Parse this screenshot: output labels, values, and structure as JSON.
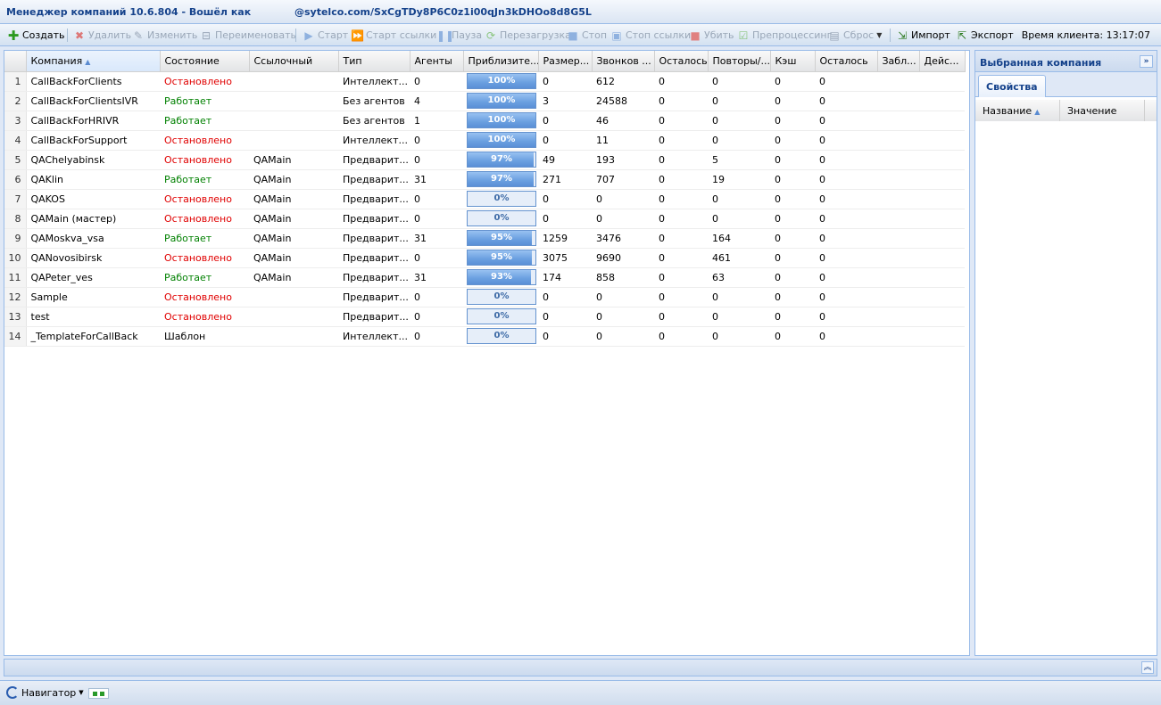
{
  "window": {
    "title": "Менеджер компаний 10.6.804 - Вошёл как",
    "user": "@sytelco.com/SxCgTDy8P6C0z1i00qJn3kDHOo8d8G5L"
  },
  "toolbar": {
    "create": "Создать",
    "delete": "Удалить",
    "edit": "Изменить",
    "rename": "Переименовать",
    "start": "Старт",
    "start_links": "Старт ссылки",
    "pause": "Пауза",
    "restart": "Перезагрузка",
    "stop": "Стоп",
    "stop_links": "Стоп ссылки",
    "kill": "Убить",
    "preprocess": "Препроцессинг",
    "reset": "Сброс",
    "import": "Импорт",
    "export": "Экспорт",
    "client_time_label": "Время клиента:",
    "client_time": "13:17:07"
  },
  "grid": {
    "columns": [
      "Компания",
      "Состояние",
      "Ссылочный",
      "Тип",
      "Агенты",
      "Приблизите...",
      "Размер...",
      "Звонков ...",
      "Осталось",
      "Повторы/...",
      "Кэш",
      "Осталось",
      "Забл...",
      "Дейс..."
    ],
    "rows": [
      {
        "n": "1",
        "name": "CallBackForClients",
        "state": "Остановлено",
        "running": false,
        "ref": "",
        "type": "Интеллект...",
        "agents": "0",
        "progress": 100,
        "progress_label": "100%",
        "size": "0",
        "calls": "612",
        "left": "0",
        "retries": "0",
        "cache": "0",
        "left2": "0"
      },
      {
        "n": "2",
        "name": "CallBackForClientsIVR",
        "state": "Работает",
        "running": true,
        "ref": "",
        "type": "Без агентов",
        "agents": "4",
        "progress": 100,
        "progress_label": "100%",
        "size": "3",
        "calls": "24588",
        "left": "0",
        "retries": "0",
        "cache": "0",
        "left2": "0"
      },
      {
        "n": "3",
        "name": "CallBackForHRIVR",
        "state": "Работает",
        "running": true,
        "ref": "",
        "type": "Без агентов",
        "agents": "1",
        "progress": 100,
        "progress_label": "100%",
        "size": "0",
        "calls": "46",
        "left": "0",
        "retries": "0",
        "cache": "0",
        "left2": "0"
      },
      {
        "n": "4",
        "name": "CallBackForSupport",
        "state": "Остановлено",
        "running": false,
        "ref": "",
        "type": "Интеллект...",
        "agents": "0",
        "progress": 100,
        "progress_label": "100%",
        "size": "0",
        "calls": "11",
        "left": "0",
        "retries": "0",
        "cache": "0",
        "left2": "0"
      },
      {
        "n": "5",
        "name": "QAChelyabinsk",
        "state": "Остановлено",
        "running": false,
        "ref": "QAMain",
        "type": "Предварит...",
        "agents": "0",
        "progress": 97,
        "progress_label": "97%",
        "size": "49",
        "calls": "193",
        "left": "0",
        "retries": "5",
        "cache": "0",
        "left2": "0"
      },
      {
        "n": "6",
        "name": "QAKlin",
        "state": "Работает",
        "running": true,
        "ref": "QAMain",
        "type": "Предварит...",
        "agents": "31",
        "progress": 97,
        "progress_label": "97%",
        "size": "271",
        "calls": "707",
        "left": "0",
        "retries": "19",
        "cache": "0",
        "left2": "0"
      },
      {
        "n": "7",
        "name": "QAKOS",
        "state": "Остановлено",
        "running": false,
        "ref": "QAMain",
        "type": "Предварит...",
        "agents": "0",
        "progress": 0,
        "progress_label": "0%",
        "size": "0",
        "calls": "0",
        "left": "0",
        "retries": "0",
        "cache": "0",
        "left2": "0"
      },
      {
        "n": "8",
        "name": "QAMain (мастер)",
        "state": "Остановлено",
        "running": false,
        "ref": "QAMain",
        "type": "Предварит...",
        "agents": "0",
        "progress": 0,
        "progress_label": "0%",
        "size": "0",
        "calls": "0",
        "left": "0",
        "retries": "0",
        "cache": "0",
        "left2": "0"
      },
      {
        "n": "9",
        "name": "QAMoskva_vsa",
        "state": "Работает",
        "running": true,
        "ref": "QAMain",
        "type": "Предварит...",
        "agents": "31",
        "progress": 95,
        "progress_label": "95%",
        "size": "1259",
        "calls": "3476",
        "left": "0",
        "retries": "164",
        "cache": "0",
        "left2": "0"
      },
      {
        "n": "10",
        "name": "QANovosibirsk",
        "state": "Остановлено",
        "running": false,
        "ref": "QAMain",
        "type": "Предварит...",
        "agents": "0",
        "progress": 95,
        "progress_label": "95%",
        "size": "3075",
        "calls": "9690",
        "left": "0",
        "retries": "461",
        "cache": "0",
        "left2": "0"
      },
      {
        "n": "11",
        "name": "QAPeter_ves",
        "state": "Работает",
        "running": true,
        "ref": "QAMain",
        "type": "Предварит...",
        "agents": "31",
        "progress": 93,
        "progress_label": "93%",
        "size": "174",
        "calls": "858",
        "left": "0",
        "retries": "63",
        "cache": "0",
        "left2": "0"
      },
      {
        "n": "12",
        "name": "Sample",
        "state": "Остановлено",
        "running": false,
        "ref": "",
        "type": "Предварит...",
        "agents": "0",
        "progress": 0,
        "progress_label": "0%",
        "size": "0",
        "calls": "0",
        "left": "0",
        "retries": "0",
        "cache": "0",
        "left2": "0"
      },
      {
        "n": "13",
        "name": "test",
        "state": "Остановлено",
        "running": false,
        "ref": "",
        "type": "Предварит...",
        "agents": "0",
        "progress": 0,
        "progress_label": "0%",
        "size": "0",
        "calls": "0",
        "left": "0",
        "retries": "0",
        "cache": "0",
        "left2": "0"
      },
      {
        "n": "14",
        "name": "_TemplateForCallBack",
        "state": "Шаблон",
        "running": null,
        "ref": "",
        "type": "Интеллект...",
        "agents": "0",
        "progress": 0,
        "progress_label": "0%",
        "size": "0",
        "calls": "0",
        "left": "0",
        "retries": "0",
        "cache": "0",
        "left2": "0"
      }
    ]
  },
  "side": {
    "title": "Выбранная компания",
    "tab": "Свойства",
    "col_name": "Название",
    "col_value": "Значение"
  },
  "status": {
    "navigator": "Навигатор"
  },
  "colors": {
    "stopped": "#e00000",
    "running": "#008000",
    "accent": "#15428b"
  }
}
